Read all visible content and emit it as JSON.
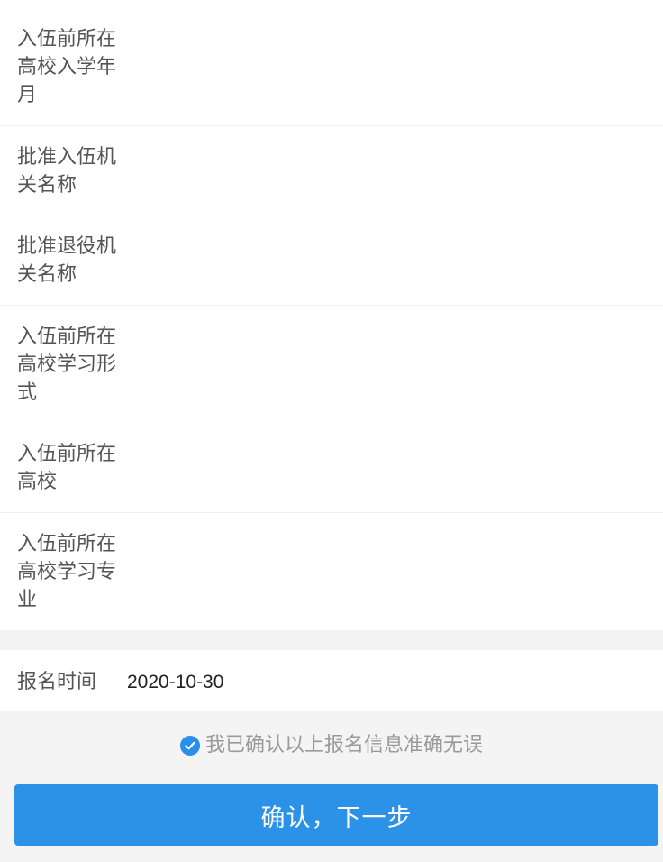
{
  "form": {
    "fields": [
      {
        "label": "入伍前所在高校入学年月",
        "value": ""
      },
      {
        "label": "批准入伍机关名称",
        "value": ""
      },
      {
        "label": "批准退役机关名称",
        "value": ""
      },
      {
        "label": "入伍前所在高校学习形式",
        "value": ""
      },
      {
        "label": "入伍前所在高校",
        "value": ""
      },
      {
        "label": "入伍前所在高校学习专业",
        "value": ""
      }
    ]
  },
  "registration": {
    "time_label": "报名时间",
    "time_value": "2020-10-30"
  },
  "confirmation": {
    "text": "我已确认以上报名信息准确无误",
    "checked": true,
    "icon": "check-circle-icon"
  },
  "actions": {
    "next_label": "确认，下一步"
  },
  "colors": {
    "primary": "#2b92e8",
    "background": "#f4f4f4",
    "label": "#555555",
    "muted": "#9a9a9a"
  }
}
